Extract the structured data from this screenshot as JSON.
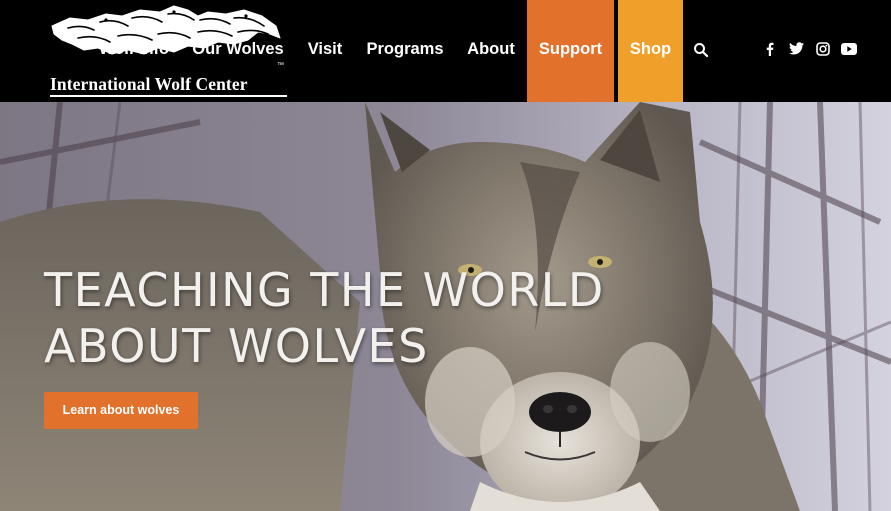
{
  "logo": {
    "name": "International Wolf Center",
    "trademark": "™"
  },
  "nav": {
    "items": [
      {
        "label": "Wolf Info"
      },
      {
        "label": "Our Wolves"
      },
      {
        "label": "Visit"
      },
      {
        "label": "Programs"
      },
      {
        "label": "About"
      },
      {
        "label": "Support"
      },
      {
        "label": "Shop"
      }
    ]
  },
  "icons": {
    "search": "search-icon",
    "facebook": "facebook-icon",
    "twitter": "twitter-icon",
    "instagram": "instagram-icon",
    "youtube": "youtube-icon"
  },
  "hero": {
    "title_line1": "TEACHING THE WORLD",
    "title_line2": "ABOUT WOLVES",
    "cta_label": "Learn about wolves",
    "image": "gray-wolf-photo"
  },
  "colors": {
    "header_bg": "#000000",
    "support_bg": "#e2712b",
    "shop_bg": "#eea02a",
    "cta_bg": "#e2712b",
    "text": "#ffffff"
  }
}
